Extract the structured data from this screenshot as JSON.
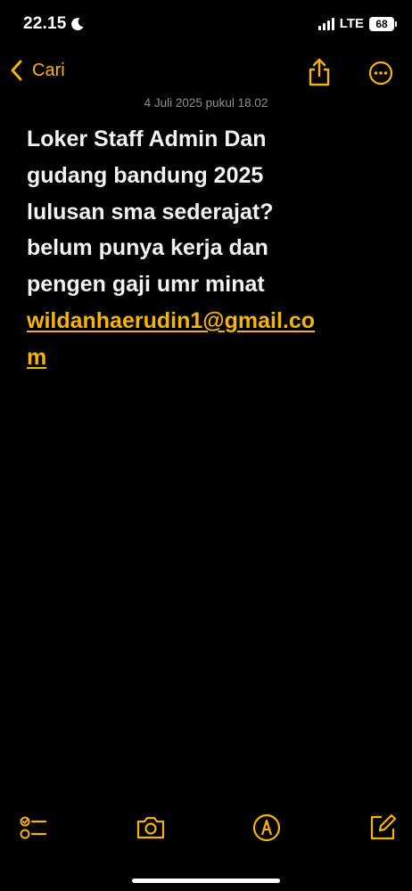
{
  "status_bar": {
    "time": "22.15",
    "network": "LTE",
    "battery": "68",
    "icons": [
      "moon-icon",
      "signal-icon"
    ]
  },
  "nav": {
    "back_label": "Cari",
    "icons": [
      "chevron-left-icon",
      "share-icon",
      "more-icon"
    ]
  },
  "note": {
    "date": "4 Juli 2025 pukul 18.02",
    "lines": [
      "Loker Staff Admin Dan",
      "gudang bandung 2025",
      "lulusan sma sederajat?",
      "belum punya kerja  dan",
      "pengen gaji umr minat"
    ],
    "email_lines": [
      "wildanhaerudin1@gmail.co",
      "m"
    ]
  },
  "toolbar": {
    "icons": [
      "checklist-icon",
      "camera-icon",
      "markup-icon",
      "compose-icon"
    ]
  },
  "colors": {
    "accent": "#f4b400",
    "background": "#000000",
    "text": "#f2f2f2",
    "muted": "#8e8e93"
  }
}
